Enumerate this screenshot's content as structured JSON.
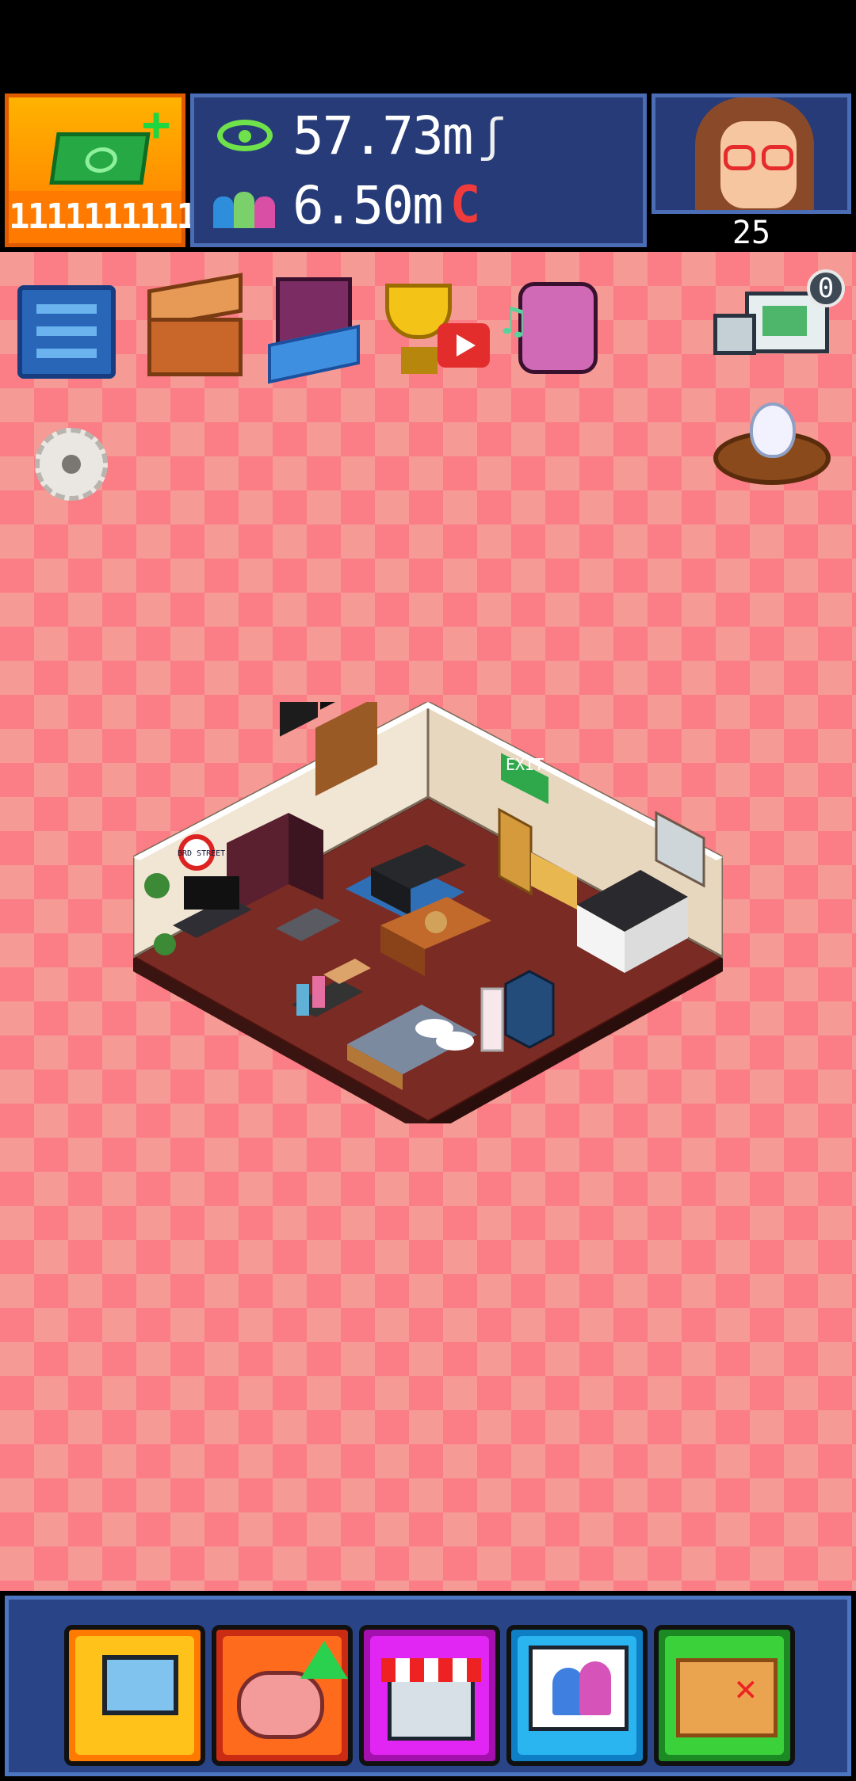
{
  "hud": {
    "cash_amount": "1111111111",
    "views": "57.73m",
    "subscribers": "6.50m",
    "level": "25",
    "delivery_count": "0"
  },
  "colors": {
    "checker_light": "#f59a95",
    "checker_dark": "#fb7d86",
    "panel_blue": "#263b78",
    "cash_orange": "#ff7a00"
  },
  "icons": {
    "top_row": [
      "menu-icon",
      "chest-icon",
      "room-icon",
      "trophy-video-icon",
      "mascot-music-icon"
    ],
    "right_side": [
      "delivery-truck-icon",
      "egg-nest-icon"
    ],
    "left_side": [
      "settings-gear-icon"
    ],
    "toolbar": [
      "computer-icon",
      "brain-upgrade-icon",
      "shop-icon",
      "collab-chat-icon",
      "treasure-map-icon"
    ]
  },
  "room_scene": {
    "exit_sign": "EXIT",
    "street_sign": "BRD STREET"
  }
}
